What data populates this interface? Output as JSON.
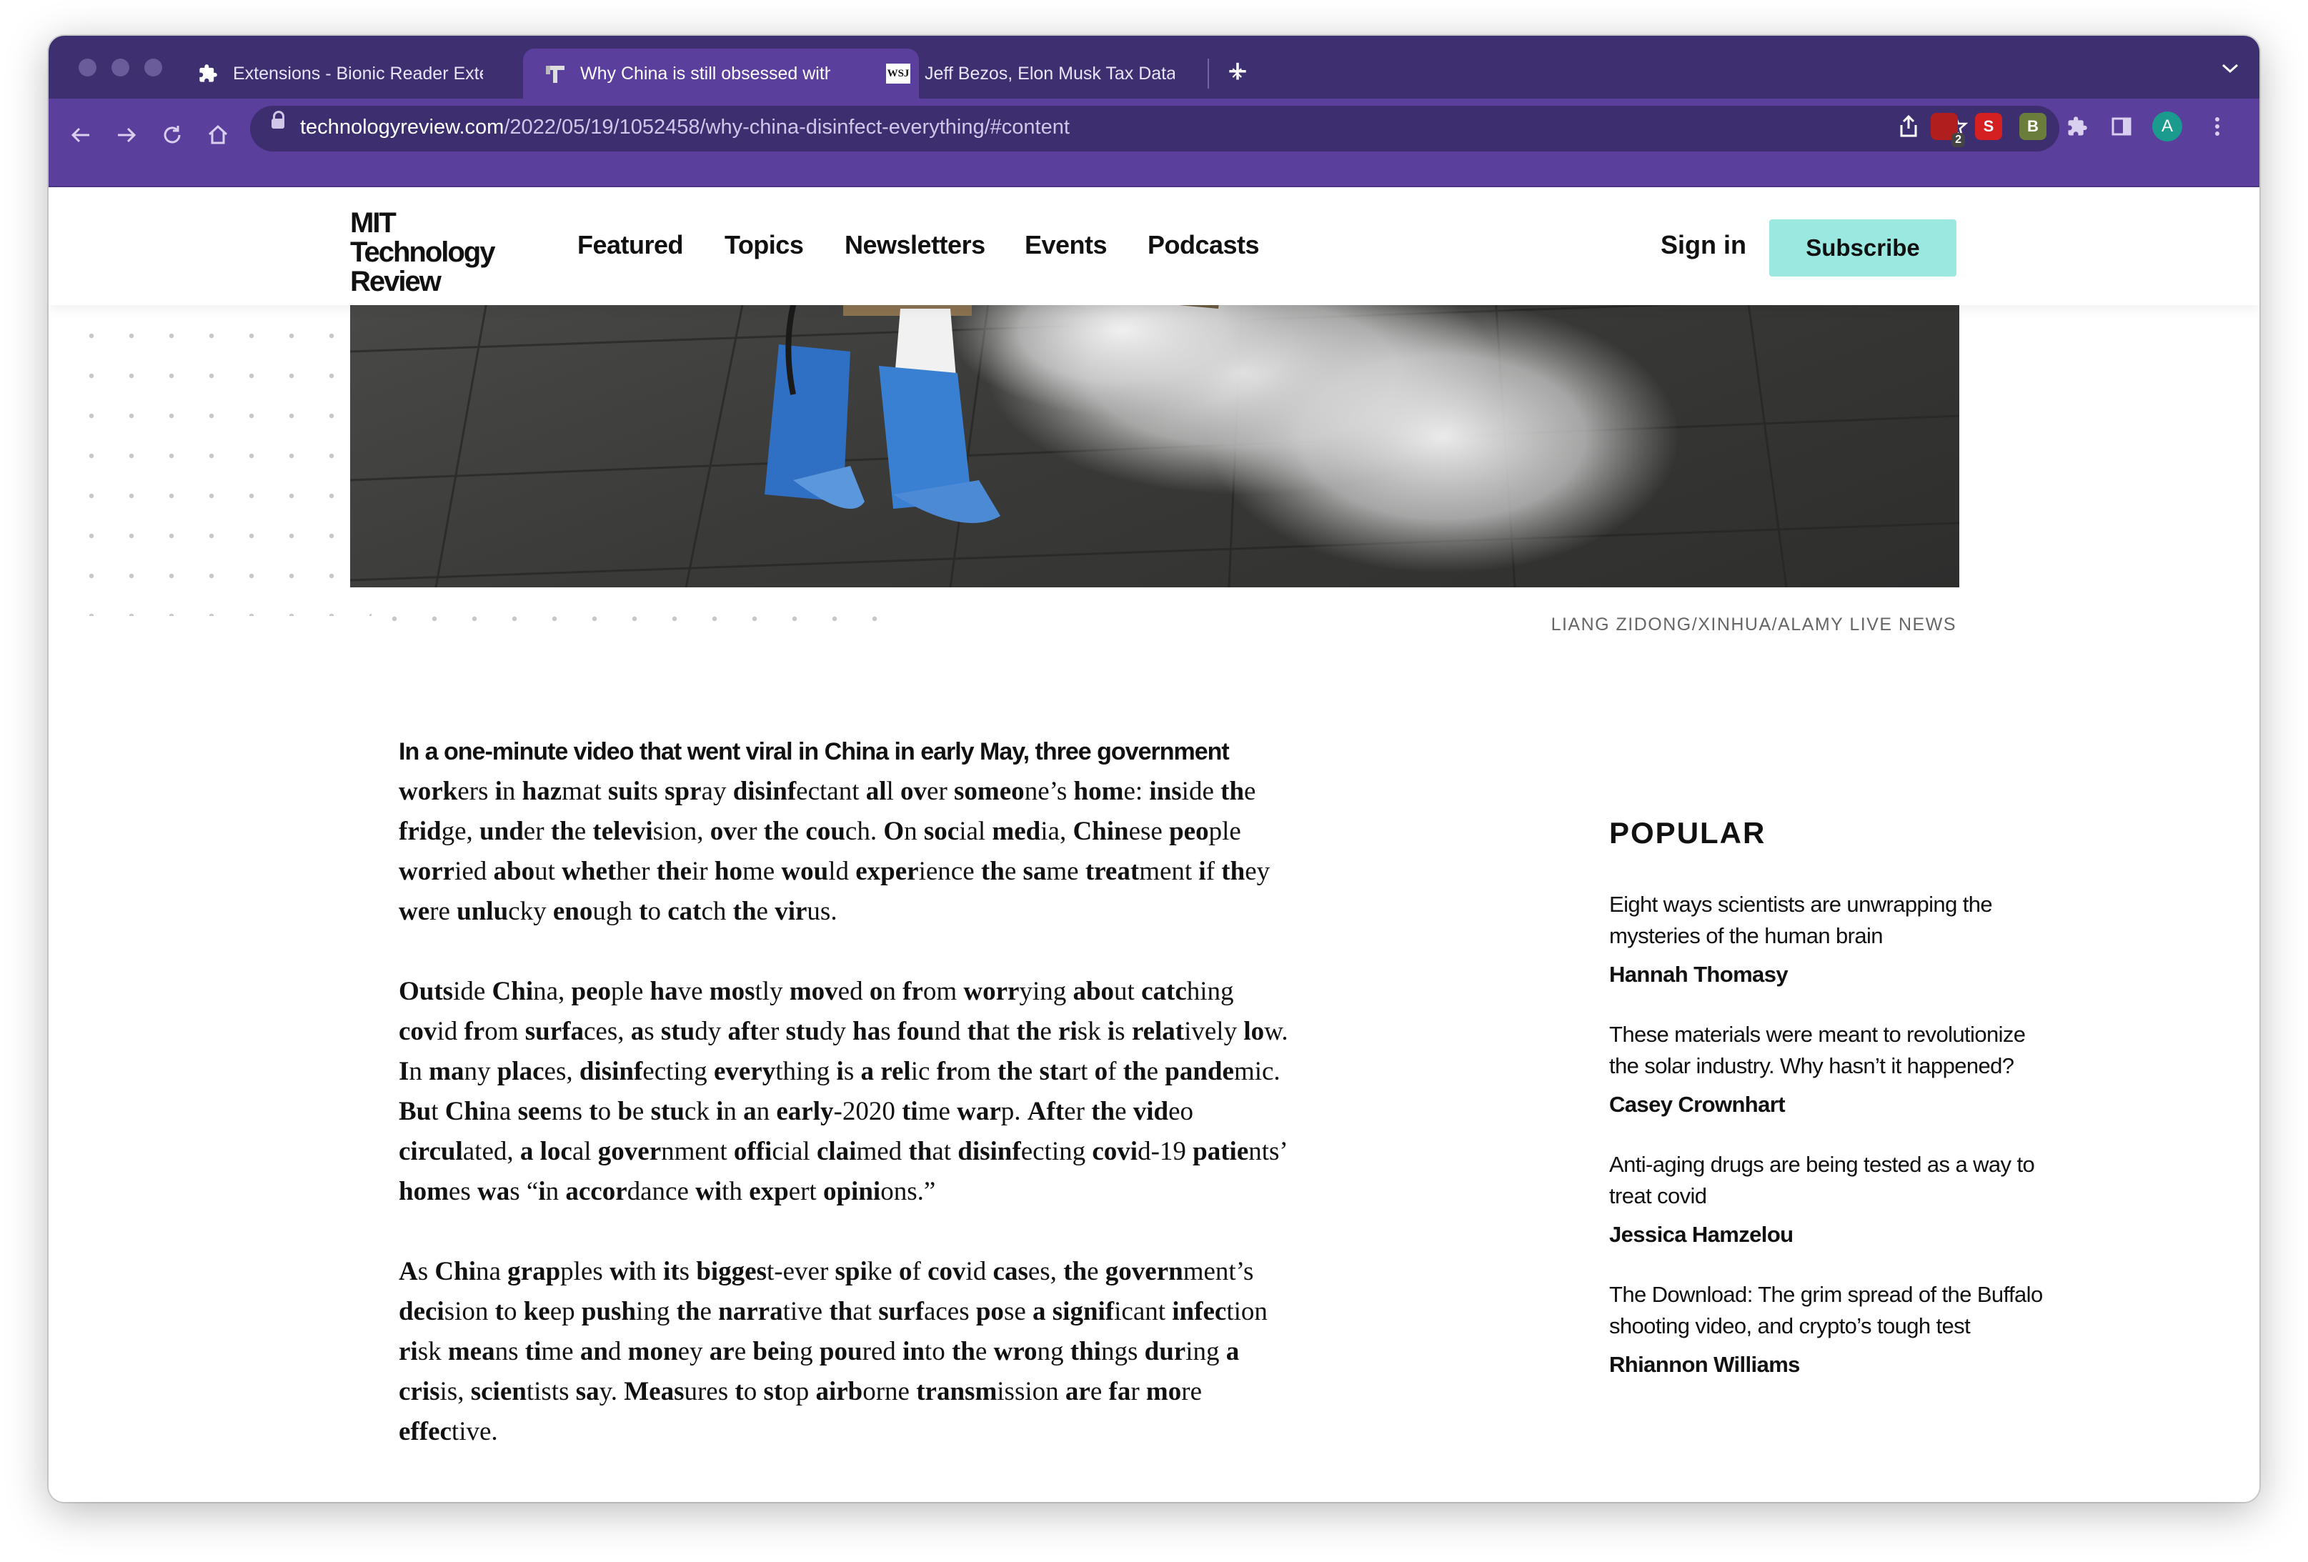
{
  "browser": {
    "tabs": [
      {
        "title": "Extensions - Bionic Reader Extension",
        "icon": "puzzle-icon",
        "active": false
      },
      {
        "title": "Why China is still obsessed with disinfecting everything",
        "icon": "mit-tr-favicon",
        "active": true
      },
      {
        "title": "Jeff Bezos, Elon Musk Tax Data",
        "icon": "wsj-favicon",
        "active": false
      }
    ],
    "favicon_wsj": "WSJ",
    "new_tab_label": "+",
    "url_domain": "technologyreview.com",
    "url_path": "/2022/05/19/1052458/why-china-disinfect-everything/#content",
    "extension_badge_count": "2",
    "extension_b_label": "B",
    "extension_s_label": "S",
    "avatar_initial": "A",
    "accent_color": "#5a3f9c"
  },
  "site": {
    "logo": "MIT\nTechnology\nReview",
    "nav": [
      "Featured",
      "Topics",
      "Newsletters",
      "Events",
      "Podcasts"
    ],
    "sign_in": "Sign in",
    "subscribe": "Subscribe",
    "subscribe_color": "#9be8e0"
  },
  "hero": {
    "credit": "LIANG ZIDONG/XINHUA/ALAMY LIVE NEWS"
  },
  "article": {
    "lead": "In a one-minute video that went viral in China in early May, three government",
    "paragraphs": [
      "workers in hazmat suits spray disinfectant all over someone’s home: inside the fridge, under the television, over the couch. On social media, Chinese people worried about whether their home would experience the same treatment if they were unlucky enough to catch the virus.",
      "Outside China, people have mostly moved on from worrying about catching covid from surfaces, as study after study has found that the risk is relatively low. In many places, disinfecting everything is a relic from the start of the pandemic. But China seems to be stuck in an early-2020 time warp. After the video circulated, a local government official claimed that disinfecting covid-19 patients’ homes was “in accordance with expert opinions.”",
      "As China grapples with its biggest-ever spike of covid cases, the government’s decision to keep pushing the narrative that surfaces pose a significant infection risk means time and money are being poured into the wrong things during a crisis, scientists say. Measures to stop airborne transmission are far more effective."
    ]
  },
  "popular": {
    "heading": "POPULAR",
    "items": [
      {
        "title": "Eight ways scientists are unwrapping the mysteries of the human brain",
        "author": "Hannah Thomasy"
      },
      {
        "title": "These materials were meant to revolutionize the solar industry. Why hasn’t it happened?",
        "author": "Casey Crownhart"
      },
      {
        "title": "Anti-aging drugs are being tested as a way to treat covid",
        "author": "Jessica Hamzelou"
      },
      {
        "title": "The Download: The grim spread of the Buffalo shooting video, and crypto’s tough test",
        "author": "Rhiannon Williams"
      }
    ]
  }
}
